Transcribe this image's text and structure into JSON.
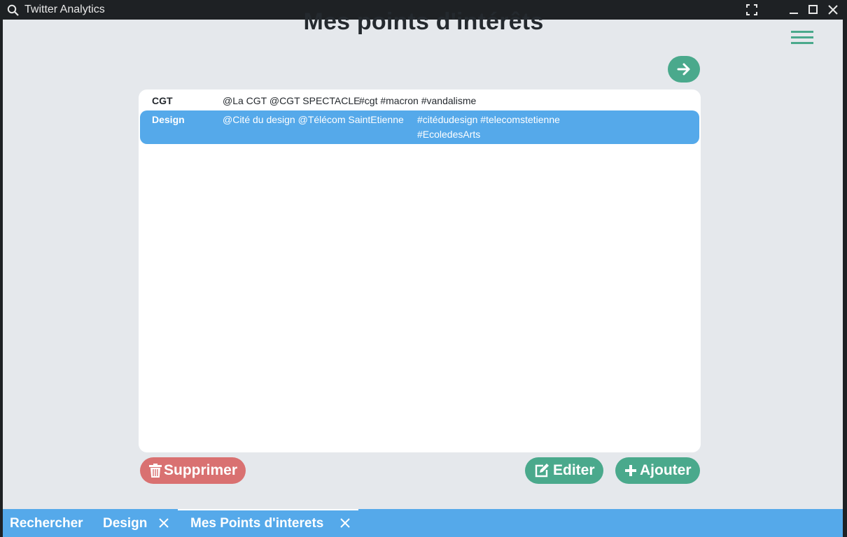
{
  "window": {
    "title": "Twitter Analytics"
  },
  "page": {
    "title": "Mes points d'intérêts"
  },
  "list": {
    "items": [
      {
        "name": "CGT",
        "mentions": "@La CGT @CGT SPECTACLE",
        "hashtags": "#cgt #macron #vandalisme",
        "selected": false
      },
      {
        "name": "Design",
        "mentions": "@Cité du design @Télécom SaintEtienne",
        "hashtags": "#citédudesign #telecomstetienne #EcoledesArts",
        "selected": true
      }
    ]
  },
  "actions": {
    "delete_label": "Supprimer",
    "edit_label": "Editer",
    "add_label": "Ajouter"
  },
  "tabs": [
    {
      "label": "Rechercher",
      "closable": false,
      "active": false
    },
    {
      "label": "Design",
      "closable": true,
      "active": false
    },
    {
      "label": "Mes Points d'interets",
      "closable": true,
      "active": true
    }
  ],
  "icons": {
    "window_search": "search-icon",
    "fullscreen": "fullscreen-icon",
    "minimize": "minimize-icon",
    "maximize": "maximize-icon",
    "close": "close-icon",
    "menu": "hamburger-menu-icon",
    "next": "arrow-right-icon",
    "delete": "trash-icon",
    "edit": "edit-icon",
    "add": "plus-icon"
  },
  "colors": {
    "accent_green": "#4aa98c",
    "danger_red": "#d97171",
    "selection_blue": "#55a9ea",
    "tabbar_blue": "#55a9ea",
    "background": "#e5e8ec"
  }
}
